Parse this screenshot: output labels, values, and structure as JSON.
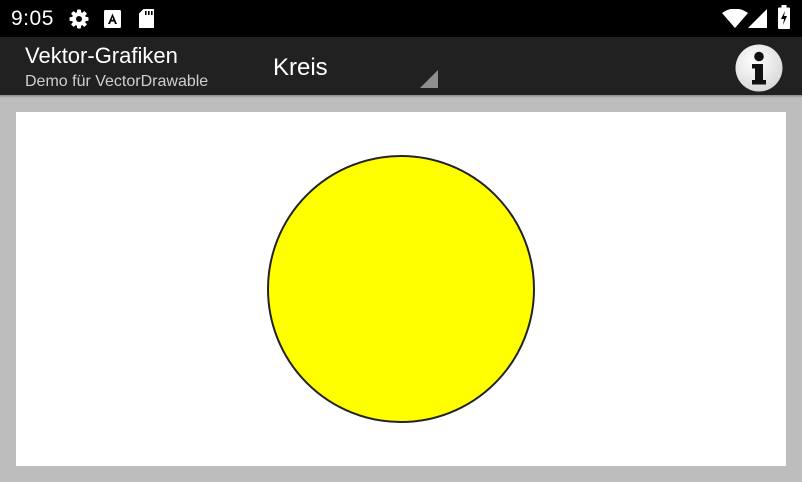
{
  "status_bar": {
    "time": "9:05",
    "left_icons": [
      "gear-icon",
      "font-a-icon",
      "sd-card-icon"
    ],
    "right_icons": [
      "wifi-icon",
      "cell-signal-icon",
      "battery-charging-icon"
    ]
  },
  "app_bar": {
    "title": "Vektor-Grafiken",
    "subtitle": "Demo für VectorDrawable",
    "shape_selector": {
      "selected": "Kreis"
    },
    "info_button_icon": "info-icon",
    "background_color": "#212121"
  },
  "canvas": {
    "background_color": "#ffffff",
    "shape": {
      "type": "circle",
      "fill_color": "#ffff00",
      "stroke_color": "#222222"
    }
  }
}
